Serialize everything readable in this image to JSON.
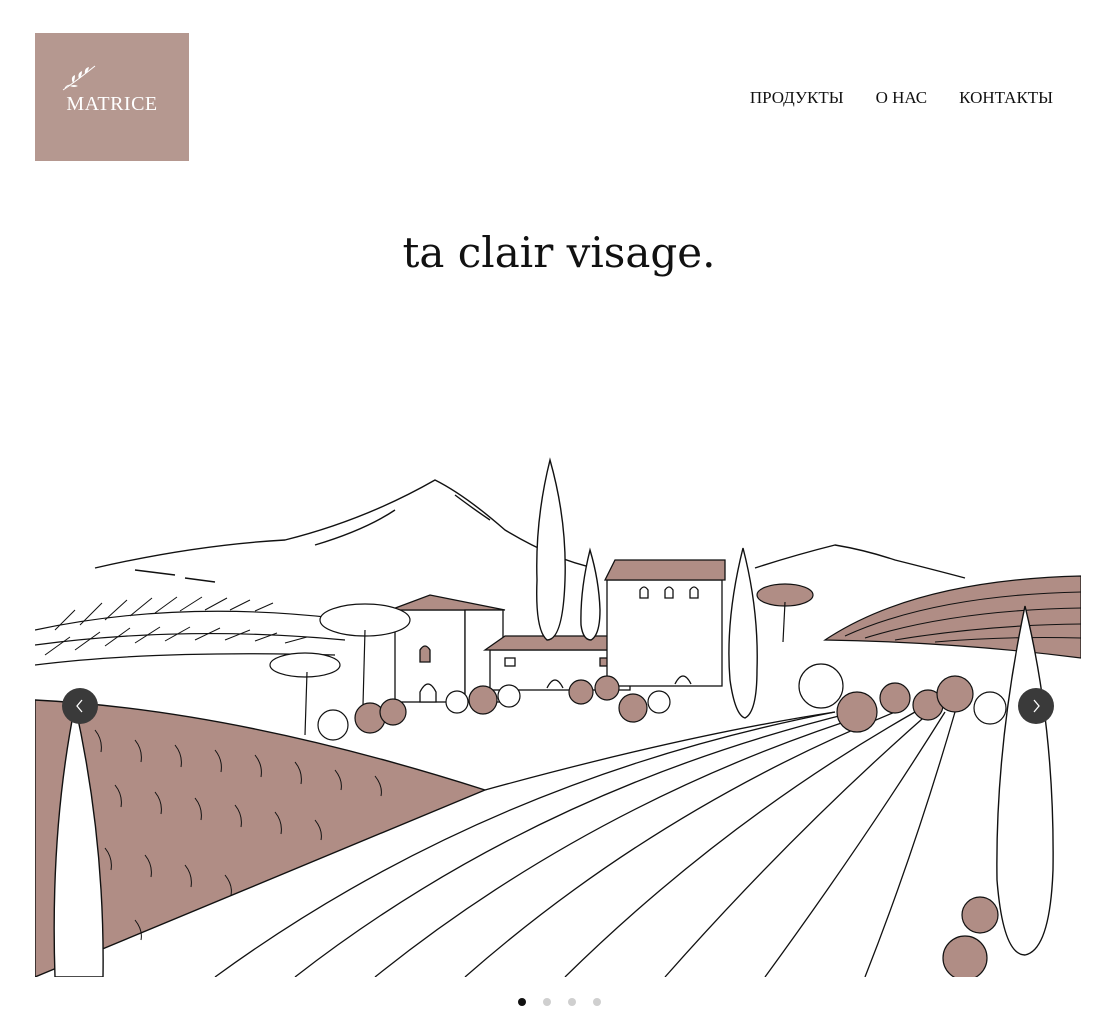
{
  "logo": {
    "text": "MATRICE",
    "icon": "olive-branch-icon",
    "background": "#b59890"
  },
  "nav": {
    "items": [
      {
        "label": "ПРОДУКТЫ"
      },
      {
        "label": "О НАС"
      },
      {
        "label": "КОНТАКТЫ"
      }
    ]
  },
  "hero": {
    "headline": "ta clair visage."
  },
  "slider": {
    "image_alt_icon": "tuscan-landscape-illustration",
    "accent_color": "#b08d85",
    "prev_icon": "chevron-left-icon",
    "next_icon": "chevron-right-icon",
    "slide_count": 4,
    "active_slide": 1
  }
}
